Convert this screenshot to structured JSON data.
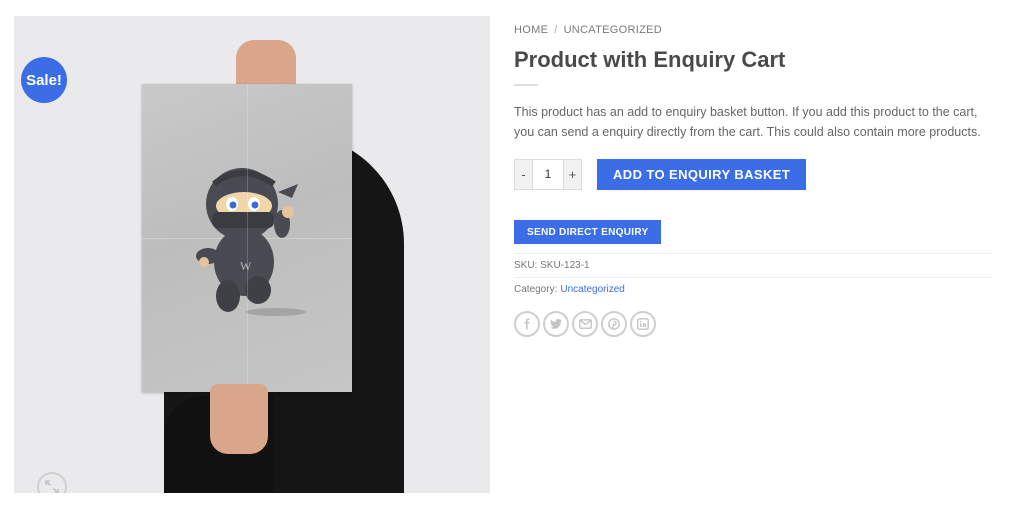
{
  "gallery": {
    "sale_badge": "Sale!",
    "zoom_icon": "expand-icon"
  },
  "breadcrumb": {
    "home": "HOME",
    "separator": "/",
    "category": "UNCATEGORIZED"
  },
  "product": {
    "title": "Product with Enquiry Cart",
    "description": "This product has an add to enquiry basket button. If you add this product to the cart, you can send a enquiry directly from the cart. This could also contain more products.",
    "sku_label": "SKU:",
    "sku_value": "SKU-123-1",
    "category_label": "Category:",
    "category_value": "Uncategorized"
  },
  "cart": {
    "minus": "-",
    "quantity": "1",
    "plus": "+",
    "add_button": "ADD TO ENQUIRY BASKET"
  },
  "enquiry": {
    "send_button": "SEND DIRECT ENQUIRY"
  },
  "share": {
    "icons": [
      "facebook-icon",
      "twitter-icon",
      "email-icon",
      "pinterest-icon",
      "linkedin-icon"
    ]
  },
  "colors": {
    "accent": "#3b6ee6",
    "text": "#555555"
  }
}
